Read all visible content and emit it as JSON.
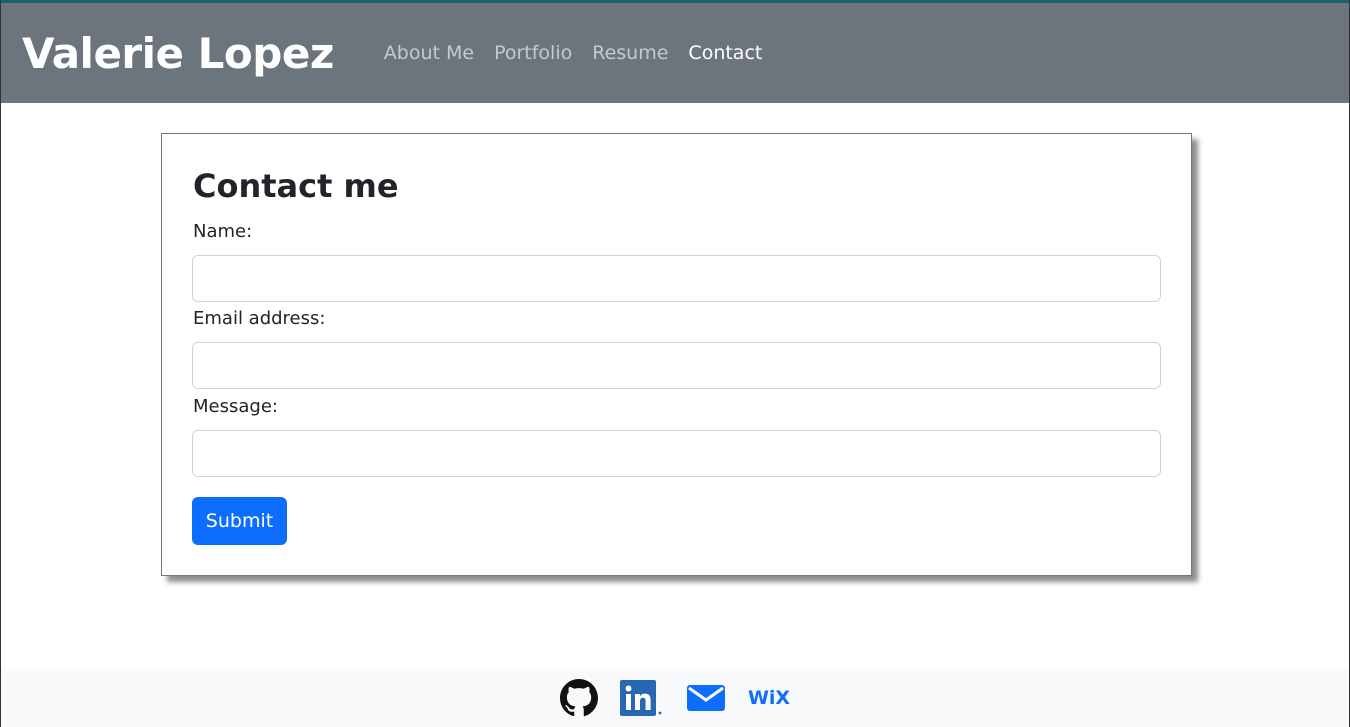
{
  "header": {
    "brand": "Valerie Lopez",
    "nav": [
      {
        "label": "About Me",
        "active": false
      },
      {
        "label": "Portfolio",
        "active": false
      },
      {
        "label": "Resume",
        "active": false
      },
      {
        "label": "Contact",
        "active": true
      }
    ]
  },
  "form": {
    "title": "Contact me",
    "name_label": "Name:",
    "name_value": "",
    "email_label": "Email address:",
    "email_value": "",
    "message_label": "Message:",
    "message_value": "",
    "submit_label": "Submit"
  },
  "footer": {
    "icons": [
      "github-icon",
      "linkedin-icon",
      "email-icon",
      "wix-icon"
    ],
    "wix_text": "WiX"
  },
  "colors": {
    "navbar": "#6c757d",
    "accent": "#0d6efd",
    "footer": "#f8f9fa"
  }
}
